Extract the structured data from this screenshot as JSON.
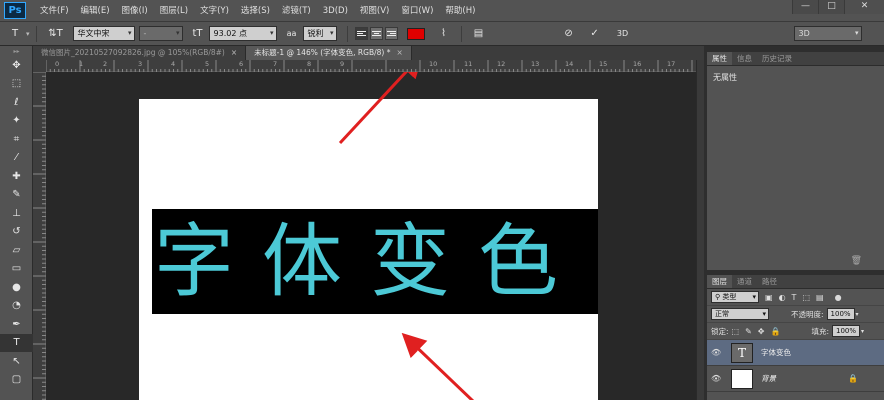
{
  "app": {
    "logo": "Ps"
  },
  "menu": [
    "文件(F)",
    "编辑(E)",
    "图像(I)",
    "图层(L)",
    "文字(Y)",
    "选择(S)",
    "滤镜(T)",
    "3D(D)",
    "视图(V)",
    "窗口(W)",
    "帮助(H)"
  ],
  "window_controls": {
    "minimize": "—",
    "maximize": "□",
    "close": "✕"
  },
  "options": {
    "tool_icon": "T",
    "orient_icon": "⇅T",
    "font_family": "华文中宋",
    "font_style": "-",
    "size_icon": "tT",
    "font_size": "93.02 点",
    "aa_icon": "aa",
    "antialias": "锐利",
    "text_color": "#e00000",
    "warp_icon": "⌇",
    "panel_icon": "▤",
    "cancel_icon": "⊘",
    "commit_icon": "✓",
    "threed_label": "3D",
    "workspace": "3D"
  },
  "tabs": [
    {
      "label": "微信图片_20210527092826.jpg @ 105%(RGB/8#)",
      "active": false
    },
    {
      "label": "未标题-1 @ 146% (字体变色, RGB/8) *",
      "active": true
    }
  ],
  "ruler": {
    "top": [
      "0",
      "1",
      "2",
      "3",
      "4",
      "5",
      "6",
      "7",
      "8",
      "9",
      "10",
      "11",
      "12",
      "13",
      "14",
      "15",
      "16",
      "17"
    ]
  },
  "canvas": {
    "text": "字体变色",
    "text_color": "#4cc9d6",
    "text_bg": "#000000"
  },
  "properties": {
    "tabs": [
      "属性",
      "信息",
      "历史记录"
    ],
    "body": "无属性"
  },
  "layers": {
    "tabs": [
      "图层",
      "通道",
      "路径"
    ],
    "filter": "类型",
    "blend_mode": "正常",
    "opacity_label": "不透明度:",
    "opacity": "100%",
    "lock_label": "锁定:",
    "fill_label": "填充:",
    "fill": "100%",
    "items": [
      {
        "name": "字体变色",
        "thumb": "T",
        "selected": true
      },
      {
        "name": "背景",
        "thumb": "",
        "selected": false
      }
    ]
  }
}
